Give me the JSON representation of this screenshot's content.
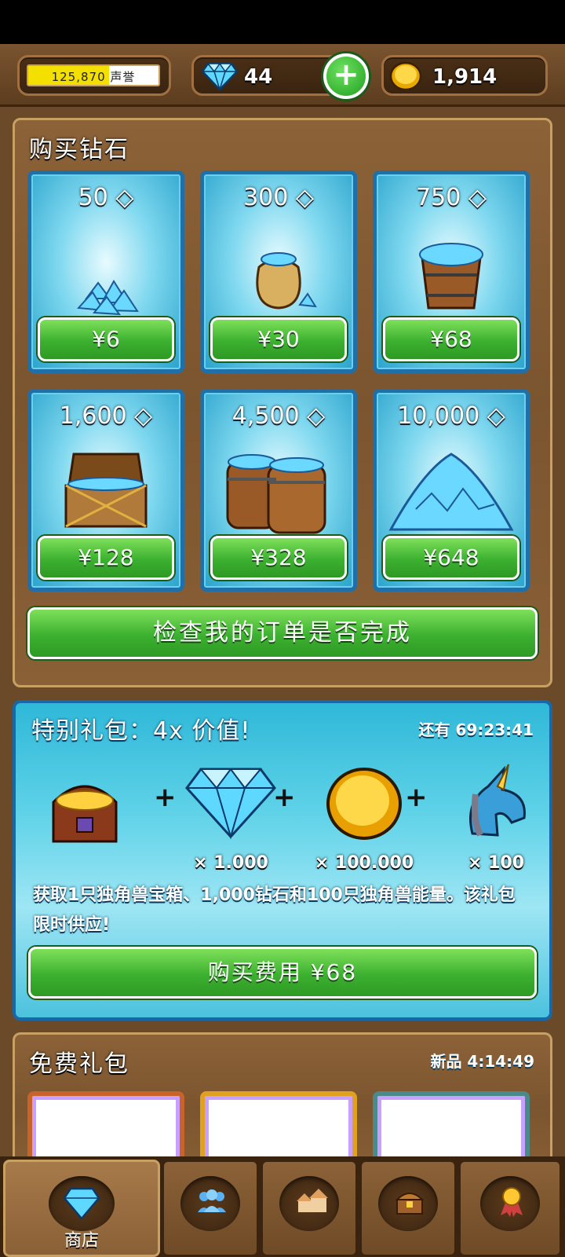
{
  "header": {
    "reputation_text": "125,870 声誉",
    "reputation_progress": 0.62,
    "gems": "44",
    "gold": "1,914"
  },
  "diamond_shop": {
    "title": "购买钻石",
    "packs": [
      {
        "amount": "50",
        "price": "¥6",
        "art": "gem-pile-icon"
      },
      {
        "amount": "300",
        "price": "¥30",
        "art": "gem-sack-icon"
      },
      {
        "amount": "750",
        "price": "¥68",
        "art": "gem-bucket-icon"
      },
      {
        "amount": "1,600",
        "price": "¥128",
        "art": "gem-chest-icon"
      },
      {
        "amount": "4,500",
        "price": "¥328",
        "art": "gem-barrels-icon"
      },
      {
        "amount": "10,000",
        "price": "¥648",
        "art": "gem-mountain-icon"
      }
    ],
    "check_order_label": "检查我的订单是否完成"
  },
  "special_offer": {
    "title": "特别礼包：4x 价值!",
    "timer": "还有 69:23:41",
    "items": [
      {
        "icon": "unicorn-chest-icon",
        "qty": ""
      },
      {
        "icon": "diamond-icon",
        "qty": "× 1.000"
      },
      {
        "icon": "gold-coin-icon",
        "qty": "× 100.000"
      },
      {
        "icon": "unicorn-head-icon",
        "qty": "× 100"
      }
    ],
    "description": "获取1只独角兽宝箱、1,000钻石和100只独角兽能量。该礼包限时供应!",
    "buy_label": "购买费用 ¥68"
  },
  "free_packs": {
    "title": "免费礼包",
    "timer": "新品 4:14:49",
    "slot_colors": [
      "#c8642a",
      "#e0a020",
      "#4a8a8a"
    ]
  },
  "nav": {
    "tabs": [
      {
        "label": "商店",
        "icon": "diamond-icon",
        "active": true
      },
      {
        "label": "",
        "icon": "people-icon",
        "active": false
      },
      {
        "label": "",
        "icon": "buildings-icon",
        "active": false
      },
      {
        "label": "",
        "icon": "treasure-chest-icon",
        "active": false
      },
      {
        "label": "",
        "icon": "medal-icon",
        "active": false
      }
    ]
  },
  "colors": {
    "accent_green": "#3cb030",
    "card_blue": "#1f6fa8",
    "wood": "#7b552f"
  }
}
